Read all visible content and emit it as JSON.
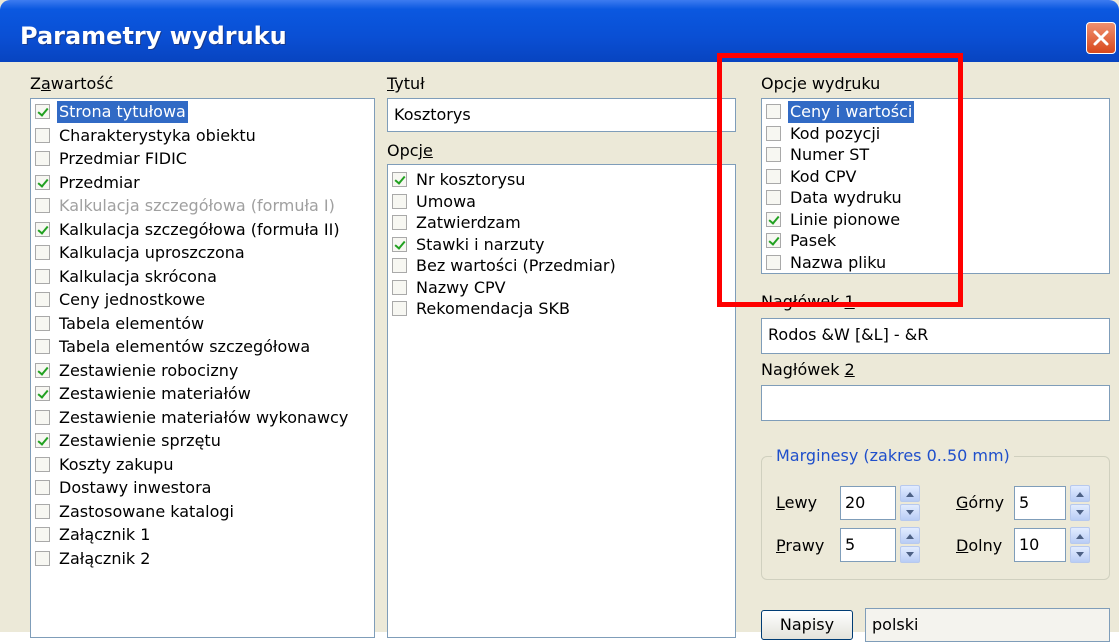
{
  "window": {
    "title": "Parametry wydruku",
    "close_symbol": "close-icon"
  },
  "zawartosc": {
    "label_pre": "Z",
    "label_u": "a",
    "label_post": "wartość",
    "items": [
      {
        "label": "Strona tytułowa",
        "checked": true,
        "selected": true,
        "disabled": false
      },
      {
        "label": "Charakterystyka obiektu",
        "checked": false,
        "selected": false,
        "disabled": false
      },
      {
        "label": "Przedmiar FIDIC",
        "checked": false,
        "selected": false,
        "disabled": false
      },
      {
        "label": "Przedmiar",
        "checked": true,
        "selected": false,
        "disabled": false
      },
      {
        "label": "Kalkulacja szczegółowa (formuła I)",
        "checked": false,
        "selected": false,
        "disabled": true
      },
      {
        "label": "Kalkulacja szczegółowa (formuła II)",
        "checked": true,
        "selected": false,
        "disabled": false
      },
      {
        "label": "Kalkulacja uproszczona",
        "checked": false,
        "selected": false,
        "disabled": false
      },
      {
        "label": "Kalkulacja skrócona",
        "checked": false,
        "selected": false,
        "disabled": false
      },
      {
        "label": "Ceny jednostkowe",
        "checked": false,
        "selected": false,
        "disabled": false
      },
      {
        "label": "Tabela elementów",
        "checked": false,
        "selected": false,
        "disabled": false
      },
      {
        "label": "Tabela elementów szczegółowa",
        "checked": false,
        "selected": false,
        "disabled": false
      },
      {
        "label": "Zestawienie robocizny",
        "checked": true,
        "selected": false,
        "disabled": false
      },
      {
        "label": "Zestawienie materiałów",
        "checked": true,
        "selected": false,
        "disabled": false
      },
      {
        "label": "Zestawienie materiałów wykonawcy",
        "checked": false,
        "selected": false,
        "disabled": false
      },
      {
        "label": "Zestawienie sprzętu",
        "checked": true,
        "selected": false,
        "disabled": false
      },
      {
        "label": "Koszty zakupu",
        "checked": false,
        "selected": false,
        "disabled": false
      },
      {
        "label": "Dostawy inwestora",
        "checked": false,
        "selected": false,
        "disabled": false
      },
      {
        "label": "Zastosowane katalogi",
        "checked": false,
        "selected": false,
        "disabled": false
      },
      {
        "label": "Załącznik 1",
        "checked": false,
        "selected": false,
        "disabled": false
      },
      {
        "label": "Załącznik 2",
        "checked": false,
        "selected": false,
        "disabled": false
      }
    ]
  },
  "tytul": {
    "label_pre": "",
    "label_u": "T",
    "label_post": "ytuł",
    "value": "Kosztorys"
  },
  "opcje": {
    "label_pre": "Opcj",
    "label_u": "e",
    "label_post": "",
    "items": [
      {
        "label": "Nr kosztorysu",
        "checked": true
      },
      {
        "label": "Umowa",
        "checked": false
      },
      {
        "label": "Zatwierdzam",
        "checked": false
      },
      {
        "label": "Stawki i narzuty",
        "checked": true
      },
      {
        "label": "Bez wartości (Przedmiar)",
        "checked": false
      },
      {
        "label": "Nazwy CPV",
        "checked": false
      },
      {
        "label": "Rekomendacja SKB",
        "checked": false
      }
    ]
  },
  "opcje_wydruku": {
    "label_pre": "Opcje wyd",
    "label_u": "r",
    "label_post": "uku",
    "items": [
      {
        "label": "Ceny i wartości",
        "checked": false,
        "selected": true
      },
      {
        "label": "Kod pozycji",
        "checked": false,
        "selected": false
      },
      {
        "label": "Numer ST",
        "checked": false,
        "selected": false
      },
      {
        "label": "Kod CPV",
        "checked": false,
        "selected": false
      },
      {
        "label": "Data wydruku",
        "checked": false,
        "selected": false
      },
      {
        "label": "Linie pionowe",
        "checked": true,
        "selected": false
      },
      {
        "label": "Pasek",
        "checked": true,
        "selected": false
      },
      {
        "label": "Nazwa pliku",
        "checked": false,
        "selected": false
      }
    ]
  },
  "naglowek1": {
    "label_pre": "Nagłówek ",
    "label_u": "1",
    "value": "Rodos &W [&L] - &R"
  },
  "naglowek2": {
    "label_pre": "Nagłówek ",
    "label_u": "2",
    "value": ""
  },
  "marginesy": {
    "title": "Marginesy (zakres 0..50 mm)",
    "lewy_u": "L",
    "lewy_post": "ewy",
    "lewy_value": "20",
    "prawy_u": "P",
    "prawy_post": "rawy",
    "prawy_value": "5",
    "gorny_u": "G",
    "gorny_post": "órny",
    "gorny_value": "5",
    "dolny_u": "D",
    "dolny_post": "olny",
    "dolny_value": "10"
  },
  "bottom": {
    "napisy_label": "Napisy",
    "language_value": "polski"
  },
  "colors": {
    "titlebar": "#0a4fd4",
    "selection": "#316ac5",
    "check": "#21a121",
    "group_title": "#1f4fcb",
    "annotation": "#ff0000"
  }
}
